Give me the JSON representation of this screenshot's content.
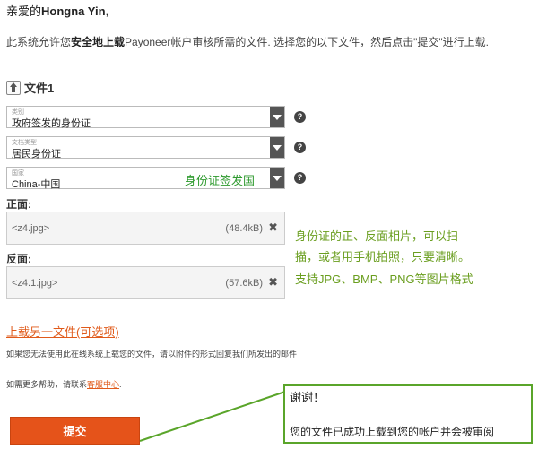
{
  "greeting": {
    "prefix": "亲爱的",
    "name": "Hongna Yin",
    "suffix": ","
  },
  "intro": {
    "part1": "此系统允许您",
    "bold": "安全地上载",
    "part2": "Payoneer帐户审核所需的文件. 选择您的以下文件，然后点击\"提交\"进行上载."
  },
  "file_section": {
    "title": "文件1"
  },
  "selects": [
    {
      "caption": "类别",
      "value": "政府签发的身份证"
    },
    {
      "caption": "文档类型",
      "value": "居民身份证"
    },
    {
      "caption": "国家",
      "value": "China-中国"
    }
  ],
  "help_glyph": "?",
  "annotations": {
    "country_note": "身份证签发国",
    "photo_note_1": "身份证的正、反面相片，可以扫",
    "photo_note_2": "描，或者用手机拍照，只要清晰。",
    "format_note": "支持JPG、BMP、PNG等图片格式"
  },
  "front": {
    "label": "正面:",
    "file_name": "<z4.jpg>",
    "size": "(48.4kB)",
    "remove": "✖"
  },
  "back": {
    "label": "反面:",
    "file_name": "<z4.1.jpg>",
    "size": "(57.6kB)",
    "remove": "✖"
  },
  "upload_another": "上载另一文件(可选项)",
  "fallback_text": "如果您无法使用此在线系统上载您的文件，请以附件的形式回复我们所发出的邮件",
  "help_text": {
    "prefix": "如需更多帮助，请联系",
    "link": "客服中心",
    "suffix": "."
  },
  "submit_label": "提交",
  "popup": {
    "line1": "谢谢！",
    "line2": "您的文件已成功上载到您的帐户并会被审阅"
  },
  "colors": {
    "accent": "#e5531a",
    "annotation_green": "#2f9a2f",
    "callout_border": "#5aa52a"
  }
}
